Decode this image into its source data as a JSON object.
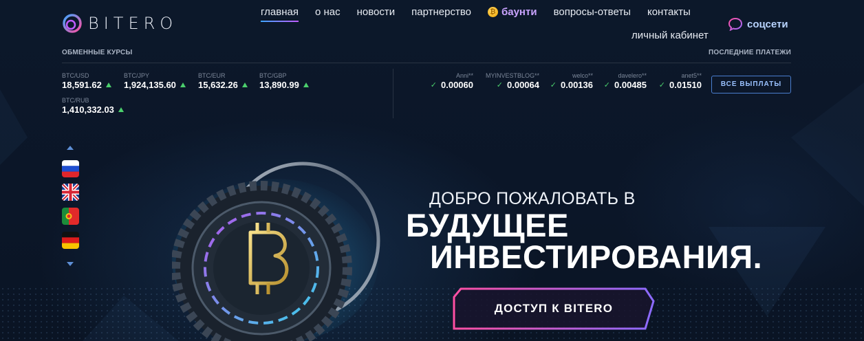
{
  "brand": {
    "name": "BITERO"
  },
  "nav": {
    "items": [
      {
        "label": "главная",
        "active": true
      },
      {
        "label": "о нас"
      },
      {
        "label": "новости"
      },
      {
        "label": "партнерство"
      },
      {
        "label": "баунти",
        "icon": "coin-icon"
      },
      {
        "label": "вопросы-ответы"
      },
      {
        "label": "контакты"
      }
    ],
    "cabinet": "личный кабинет",
    "social": "соцсети"
  },
  "rates": {
    "title": "ОБМЕННЫЕ КУРСЫ",
    "items": [
      {
        "pair": "BTC/USD",
        "value": "18,591.62"
      },
      {
        "pair": "BTC/JPY",
        "value": "1,924,135.60"
      },
      {
        "pair": "BTC/EUR",
        "value": "15,632.26"
      },
      {
        "pair": "BTC/GBP",
        "value": "13,890.99"
      },
      {
        "pair": "BTC/RUB",
        "value": "1,410,332.03"
      }
    ]
  },
  "payments": {
    "title": "ПОСЛЕДНИЕ ПЛАТЕЖИ",
    "items": [
      {
        "user": "Anni**",
        "amount": "0.00060"
      },
      {
        "user": "MYINVESTBLOG**",
        "amount": "0.00064"
      },
      {
        "user": "welco**",
        "amount": "0.00136"
      },
      {
        "user": "davelero**",
        "amount": "0.00485"
      },
      {
        "user": "anet5**",
        "amount": "0.01510"
      }
    ],
    "all_button": "ВСЕ ВЫПЛАТЫ"
  },
  "languages": [
    "ru-flag-icon",
    "uk-flag-icon",
    "portugal-flag-icon",
    "germany-flag-icon"
  ],
  "hero": {
    "welcome": "ДОБРО ПОЖАЛОВАТЬ В",
    "line1": "БУДУЩЕЕ",
    "line2": "ИНВЕСТИРОВАНИЯ.",
    "cta": "ДОСТУП К BITERO"
  },
  "colors": {
    "background": "#0b1729",
    "accent_blue": "#3ea6ff",
    "accent_purple": "#c05cff",
    "accent_pink": "#ff4fa3",
    "up_green": "#4bcf6c"
  }
}
